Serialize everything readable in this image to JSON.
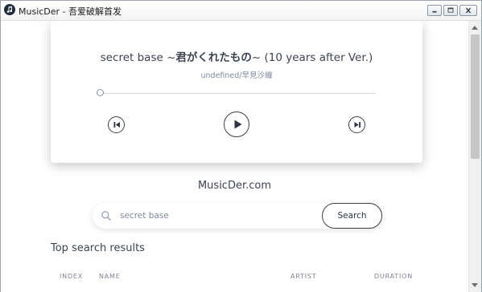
{
  "window": {
    "title": "MusicDer - 吾爱破解首发"
  },
  "player": {
    "title_prefix": "secret base ~",
    "title_jp": "君がくれたもの",
    "title_suffix": "~ (10 years after Ver.)",
    "artist": "undefined/早見沙織",
    "progress": 0
  },
  "site": {
    "name": "MusicDer.com"
  },
  "search": {
    "value": "secret base",
    "button_label": "Search"
  },
  "results": {
    "heading": "Top search results",
    "columns": {
      "index": "INDEX",
      "name": "NAME",
      "artist": "ARTIST",
      "duration": "DURATION"
    }
  },
  "icons": {
    "app": "music-note-icon",
    "search": "search-icon",
    "prev": "skip-previous-icon",
    "play": "play-icon",
    "next": "skip-next-icon"
  },
  "colors": {
    "text_primary": "#3d4451",
    "text_muted": "#7c8a9d",
    "accent_dark": "#3a3f47"
  }
}
